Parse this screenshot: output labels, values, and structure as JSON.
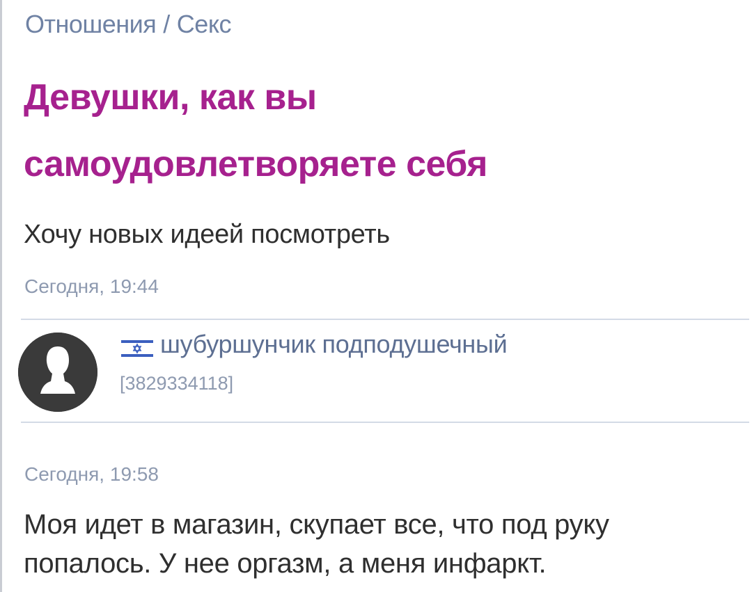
{
  "breadcrumb": {
    "parent": "Отношения",
    "separator": "/",
    "current": "Секс"
  },
  "post": {
    "title_line1": "Девушки, как вы",
    "title_line2": "самоудовлетворяете себя",
    "body": "Хочу новых идеей посмотреть",
    "time": "Сегодня, 19:44"
  },
  "reply": {
    "author": {
      "avatar_icon": "user-silhouette-icon",
      "flag_icon": "israel-flag-icon",
      "name": "шубуршунчик подподушечный",
      "id": "[3829334118]"
    },
    "time": "Сегодня, 19:58",
    "text": "Моя идет в магазин, скупает все, что под руку попалось. У нее оргазм, а меня инфаркт."
  },
  "colors": {
    "title": "#a6218e",
    "link": "#6f82a4",
    "muted": "#8e9ab0",
    "text": "#2f2f2f",
    "divider": "#d3dae6",
    "avatar_bg": "#3a3a3a"
  }
}
